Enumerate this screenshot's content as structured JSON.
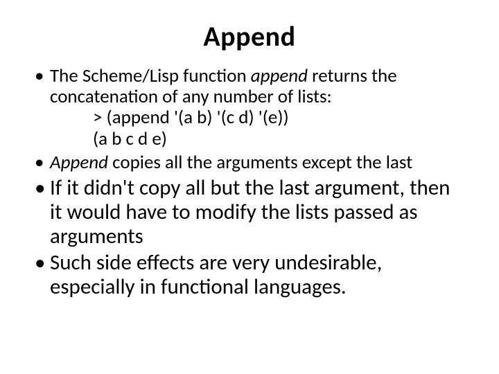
{
  "title": "Append",
  "bullets": {
    "b1_pre": "The Scheme/Lisp function ",
    "b1_em": "append",
    "b1_post": " returns the concatenation of any number of lists:",
    "b1_code1": ">  (append  '(a  b)  '(c  d)  '(e))",
    "b1_code2": "(a b c d e)",
    "b2_em": "Append",
    "b2_post": " copies all the arguments except the last",
    "b3": "If it didn't copy all but the last argument, then it would have to modify the lists passed as arguments",
    "b4": "Such side effects are very undesirable, especially in functional languages."
  }
}
